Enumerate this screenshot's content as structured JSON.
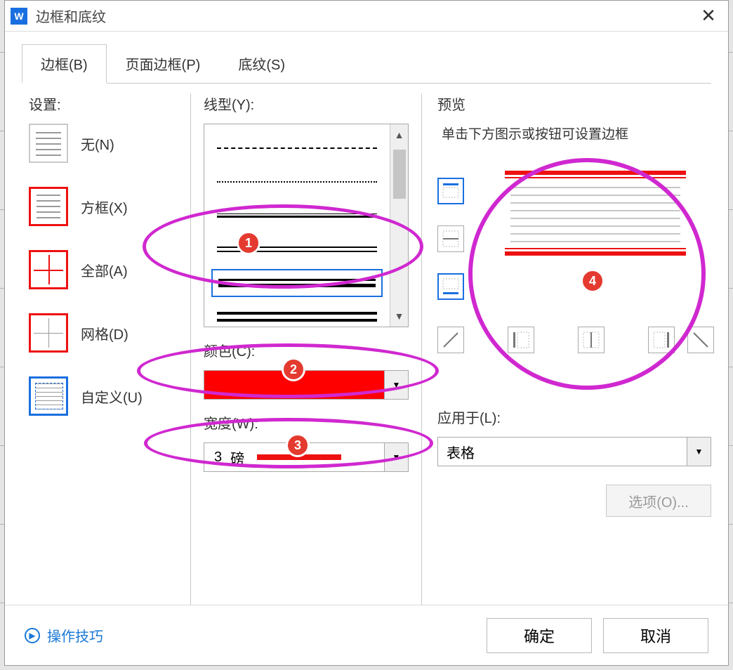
{
  "window": {
    "title": "边框和底纹"
  },
  "tabs": {
    "border": "边框(B)",
    "pageBorder": "页面边框(P)",
    "shading": "底纹(S)"
  },
  "settings": {
    "label": "设置:",
    "none": "无(N)",
    "box": "方框(X)",
    "all": "全部(A)",
    "grid": "网格(D)",
    "custom": "自定义(U)"
  },
  "lineStyle": {
    "label": "线型(Y):"
  },
  "color": {
    "label": "颜色(C):",
    "value": "#ff0000"
  },
  "width": {
    "label": "宽度(W):",
    "value": "3",
    "unit": "磅"
  },
  "preview": {
    "label": "预览",
    "hint": "单击下方图示或按钮可设置边框"
  },
  "applyTo": {
    "label": "应用于(L):",
    "value": "表格"
  },
  "buttons": {
    "options": "选项(O)...",
    "ok": "确定",
    "cancel": "取消",
    "tips": "操作技巧"
  },
  "callouts": {
    "1": "1",
    "2": "2",
    "3": "3",
    "4": "4"
  }
}
